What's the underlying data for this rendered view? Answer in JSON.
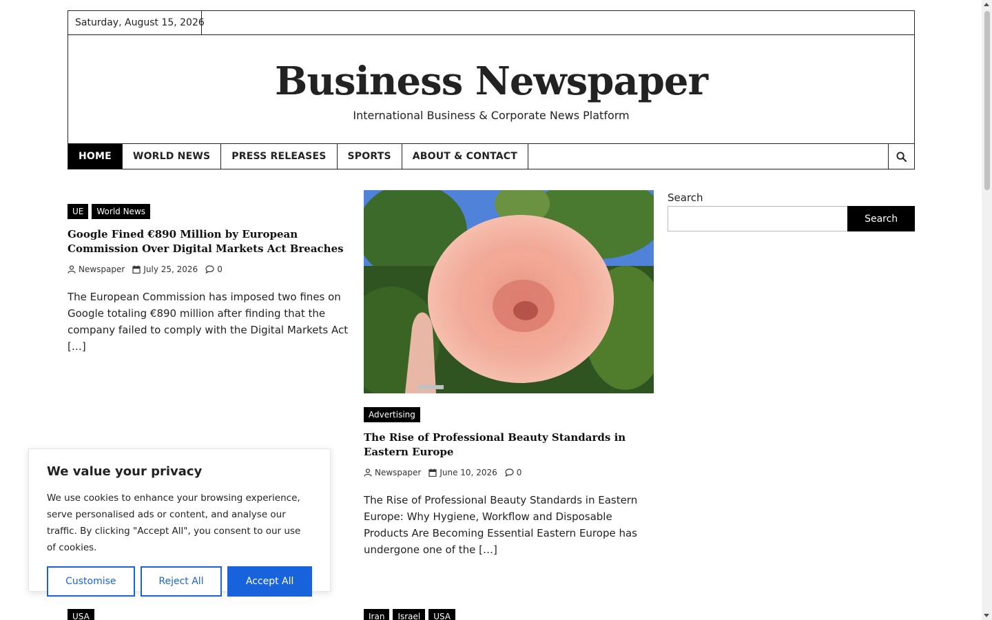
{
  "topbar": {
    "date": "Saturday, August 15, 2026"
  },
  "header": {
    "title": "Business Newspaper",
    "tagline": "International Business & Corporate News Platform"
  },
  "nav": {
    "items": [
      {
        "label": "HOME"
      },
      {
        "label": "WORLD NEWS"
      },
      {
        "label": "PRESS RELEASES"
      },
      {
        "label": "SPORTS"
      },
      {
        "label": "ABOUT & CONTACT"
      }
    ],
    "search_icon": "search-icon"
  },
  "articles": [
    {
      "tags": [
        "UE",
        "World News"
      ],
      "title": "Google Fined €890 Million by European Commission Over Digital Markets Act Breaches",
      "author": "Newspaper",
      "date": "July 25, 2026",
      "comments": "0",
      "excerpt": "The European Commission has imposed two fines on Google totaling €890 million after finding that the company failed to comply with the Digital Markets Act […]"
    },
    {
      "image": "rose-photo",
      "tags": [
        "Advertising"
      ],
      "title": "The Rise of Professional Beauty Standards in Eastern Europe",
      "author": "Newspaper",
      "date": "June 10, 2026",
      "comments": "0",
      "excerpt": "The Rise of Professional Beauty Standards in Eastern Europe: Why Hygiene, Workflow and Disposable Products Are Becoming Essential Eastern Europe has undergone one of the […]"
    },
    {
      "tags": [
        "USA"
      ]
    },
    {
      "tags": [
        "Iran",
        "Israel",
        "USA"
      ]
    }
  ],
  "sidebar": {
    "search_label": "Search",
    "search_button": "Search",
    "search_value": ""
  },
  "cookie": {
    "title": "We value your privacy",
    "text": "We use cookies to enhance your browsing experience, serve personalised ads or content, and analyse our traffic. By clicking \"Accept All\", you consent to our use of cookies.",
    "customise": "Customise",
    "reject": "Reject All",
    "accept": "Accept All",
    "accent": "#1863dc"
  }
}
